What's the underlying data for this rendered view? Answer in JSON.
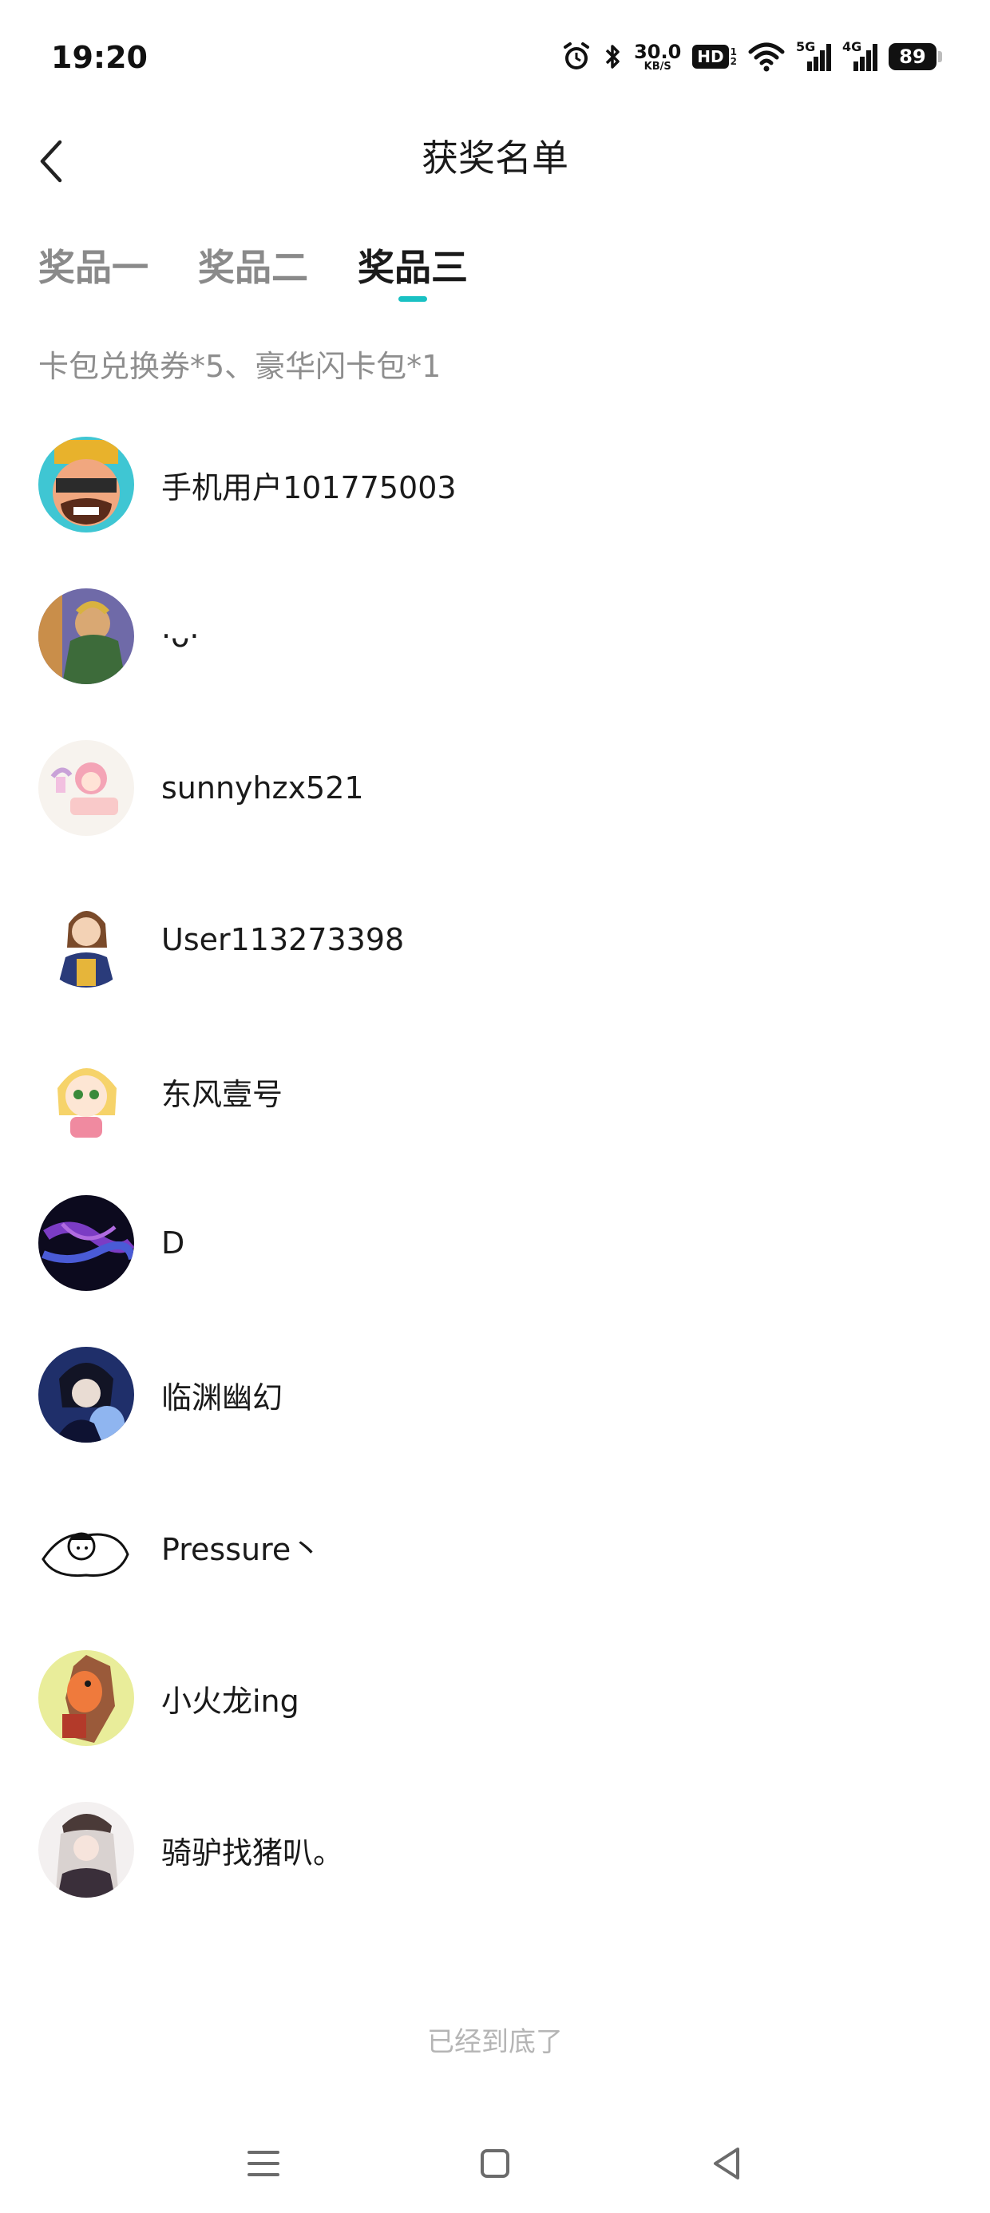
{
  "status_bar": {
    "time": "19:20",
    "net_speed_value": "30.0",
    "net_speed_unit": "KB/S",
    "hd_label": "HD",
    "hd_sim_top": "1",
    "hd_sim_bottom": "2",
    "sim1_gen": "5G",
    "sim2_gen": "4G",
    "battery": "89"
  },
  "header": {
    "title": "获奖名单"
  },
  "tabs": [
    {
      "label": "奖品一",
      "active": false
    },
    {
      "label": "奖品二",
      "active": false
    },
    {
      "label": "奖品三",
      "active": true
    }
  ],
  "prize_description": "卡包兑换券*5、豪华闪卡包*1",
  "winners": [
    {
      "name": "手机用户101775003"
    },
    {
      "name": "·ᴗ·"
    },
    {
      "name": "sunnyhzx521"
    },
    {
      "name": "User113273398"
    },
    {
      "name": "东风壹号"
    },
    {
      "name": "D"
    },
    {
      "name": "临渊幽幻"
    },
    {
      "name": "Pressure丶"
    },
    {
      "name": "小火龙ing"
    },
    {
      "name": "骑驴找猪叭。"
    }
  ],
  "end_of_list": "已经到底了",
  "colors": {
    "accent": "#19c1c3",
    "inactive_tab": "#8a8a8a",
    "secondary_text": "#8e8e8e"
  }
}
